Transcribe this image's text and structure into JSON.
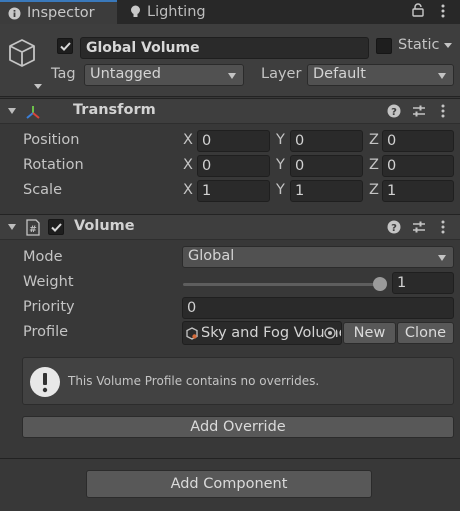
{
  "tabs": [
    {
      "label": "Inspector",
      "icon": "info-icon"
    },
    {
      "label": "Lighting",
      "icon": "bulb-icon"
    }
  ],
  "object": {
    "active": true,
    "name": "Global Volume",
    "static_label": "Static",
    "static_checked": false,
    "tag_label": "Tag",
    "tag_value": "Untagged",
    "layer_label": "Layer",
    "layer_value": "Default"
  },
  "transform": {
    "title": "Transform",
    "rows": [
      {
        "label": "Position",
        "x": "0",
        "y": "0",
        "z": "0"
      },
      {
        "label": "Rotation",
        "x": "0",
        "y": "0",
        "z": "0"
      },
      {
        "label": "Scale",
        "x": "1",
        "y": "1",
        "z": "1"
      }
    ],
    "axes": [
      "X",
      "Y",
      "Z"
    ]
  },
  "volume": {
    "title": "Volume",
    "enabled": true,
    "mode_label": "Mode",
    "mode_value": "Global",
    "weight_label": "Weight",
    "weight_value": "1",
    "weight_fraction": 1.0,
    "priority_label": "Priority",
    "priority_value": "0",
    "profile_label": "Profile",
    "profile_value": "Sky and Fog Volume",
    "new_label": "New",
    "clone_label": "Clone",
    "help_message": "This Volume Profile contains no overrides.",
    "add_override_label": "Add Override"
  },
  "add_component_label": "Add Component",
  "colors": {
    "accent": "#3a79bb",
    "background": "#383838",
    "field": "#2a2a2a",
    "button": "#585858"
  }
}
